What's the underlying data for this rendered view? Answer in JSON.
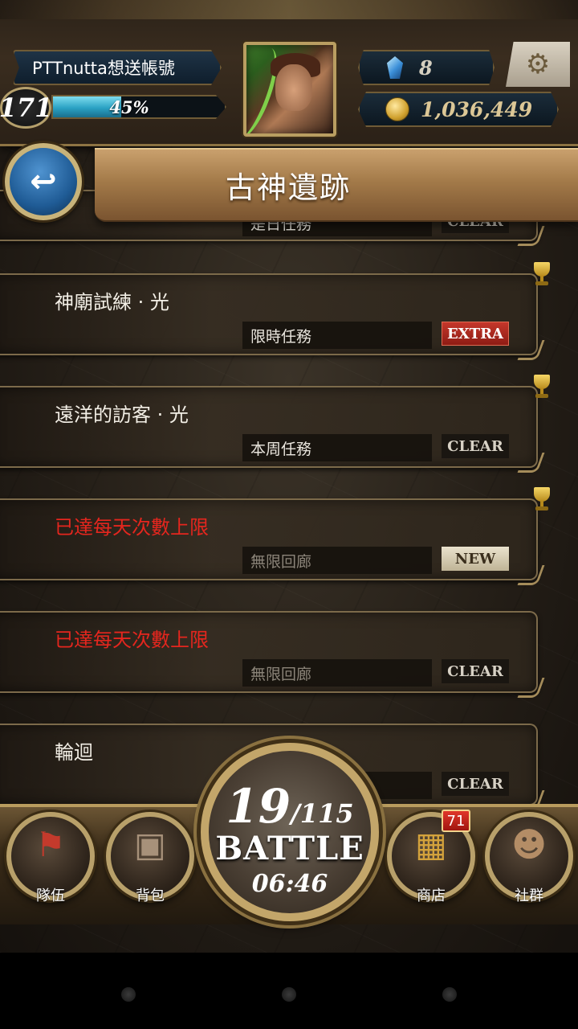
{
  "player": {
    "name": "PTTnutta想送帳號",
    "level": "171",
    "exp_percent_text": "45%",
    "exp_fraction": 0.45,
    "gems": "8",
    "coins": "1,036,449"
  },
  "header": {
    "title": "古神遺跡",
    "back_icon": "back-arrow-icon",
    "settings_icon": "gear-icon"
  },
  "partial_card": {
    "tag": "是日任務",
    "badge": "CLEAR"
  },
  "quests": [
    {
      "name": "神廟試練 · 光",
      "limit": false,
      "tag": "限時任務",
      "tag_dim": false,
      "badge": "EXTRA",
      "badge_style": "extra",
      "trophy": true
    },
    {
      "name": "遠洋的訪客 · 光",
      "limit": false,
      "tag": "本周任務",
      "tag_dim": false,
      "badge": "CLEAR",
      "badge_style": "clear",
      "trophy": true
    },
    {
      "name": "已達每天次數上限",
      "limit": true,
      "tag": "無限回廊",
      "tag_dim": true,
      "badge": "NEW",
      "badge_style": "new",
      "trophy": true
    },
    {
      "name": "已達每天次數上限",
      "limit": true,
      "tag": "無限回廊",
      "tag_dim": true,
      "badge": "CLEAR",
      "badge_style": "clear",
      "trophy": false
    },
    {
      "name": "輪迴",
      "limit": false,
      "tag": "",
      "tag_dim": false,
      "badge": "CLEAR",
      "badge_style": "clear",
      "trophy": false
    }
  ],
  "battle": {
    "current": "19",
    "max": "/115",
    "label": "BATTLE",
    "timer": "06:46"
  },
  "nav": {
    "team_label": "隊伍",
    "bag_label": "背包",
    "shop_label": "商店",
    "shop_badge": "71",
    "social_label": "社群",
    "team_icon": "flag-icon",
    "bag_icon": "backpack-icon",
    "shop_icon": "treasure-chest-icon",
    "social_icon": "people-icon"
  },
  "colors": {
    "limit_text": "#e5261e",
    "exp_bar": "#2aa2c4",
    "extra_badge": "#c5372b",
    "gold_frame": "#b99e61"
  }
}
